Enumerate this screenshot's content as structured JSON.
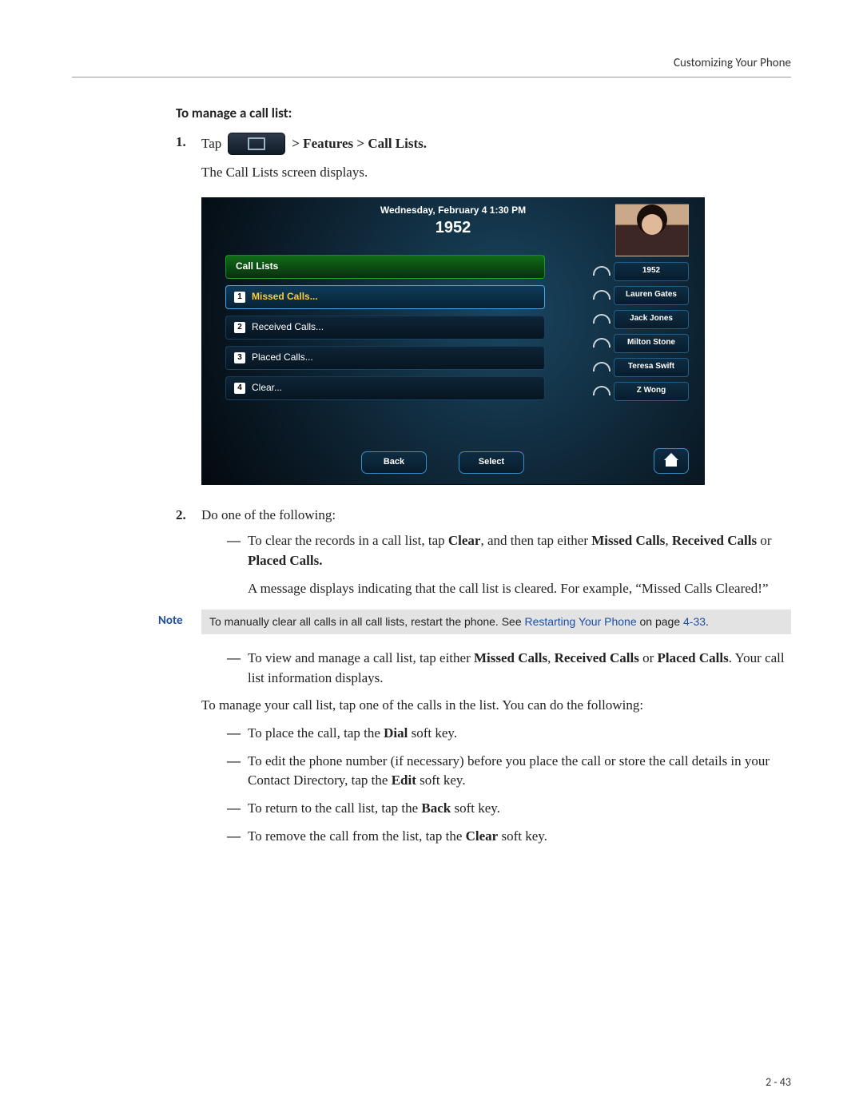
{
  "header": {
    "running_head": "Customizing Your Phone"
  },
  "heading": "To manage a call list:",
  "steps": {
    "s1": {
      "num": "1.",
      "tap": "Tap",
      "crumb": "  >  Features  >  Call Lists.",
      "after": "The Call Lists screen displays."
    },
    "s2": {
      "num": "2.",
      "text": "Do one of the following:"
    }
  },
  "screenshot": {
    "datetime": "Wednesday, February 4  1:30 PM",
    "ext": "1952",
    "list_title": "Call Lists",
    "items": [
      {
        "n": "1",
        "label": "Missed Calls...",
        "selected": true
      },
      {
        "n": "2",
        "label": "Received Calls...",
        "selected": false
      },
      {
        "n": "3",
        "label": "Placed Calls...",
        "selected": false
      },
      {
        "n": "4",
        "label": "Clear...",
        "selected": false
      }
    ],
    "contacts": [
      "1952",
      "Lauren Gates",
      "Jack Jones",
      "Milton Stone",
      "Teresa Swift",
      "Z Wong"
    ],
    "softkeys": {
      "back": "Back",
      "select": "Select"
    }
  },
  "bullets_a": {
    "b1_a": "To clear the records in a call list, tap ",
    "b1_b": "Clear",
    "b1_c": ", and then tap either ",
    "b1_d": "Missed Calls",
    "b1_e": ", ",
    "b1_f": "Received Calls",
    "b1_g": " or ",
    "b1_h": "Placed Calls.",
    "b1_follow": "A message displays indicating that the call list is cleared. For example, “Missed Calls Cleared!”"
  },
  "note": {
    "label": "Note",
    "text_a": "To manually clear all calls in all call lists, restart the phone. See ",
    "link": "Restarting Your Phone",
    "text_b": " on page ",
    "page_ref": "4-33",
    "text_c": "."
  },
  "bullets_b": {
    "b2_a": "To view and manage a call list, tap either ",
    "b2_b": "Missed Calls",
    "b2_c": ", ",
    "b2_d": "Received Calls",
    "b2_e": " or ",
    "b2_f": "Placed Calls",
    "b2_g": ". Your call list information displays.",
    "intro": "To manage your call list, tap one of the calls in the list. You can do the following:",
    "c1_a": "To place the call, tap the ",
    "c1_b": "Dial",
    "c1_c": " soft key.",
    "c2_a": "To edit the phone number (if necessary) before you place the call or store the call details in your Contact Directory, tap the ",
    "c2_b": "Edit",
    "c2_c": " soft key.",
    "c3_a": "To return to the call list, tap the ",
    "c3_b": "Back",
    "c3_c": " soft key.",
    "c4_a": "To remove the call from the list, tap the ",
    "c4_b": "Clear",
    "c4_c": " soft key."
  },
  "page_num": "2 - 43"
}
